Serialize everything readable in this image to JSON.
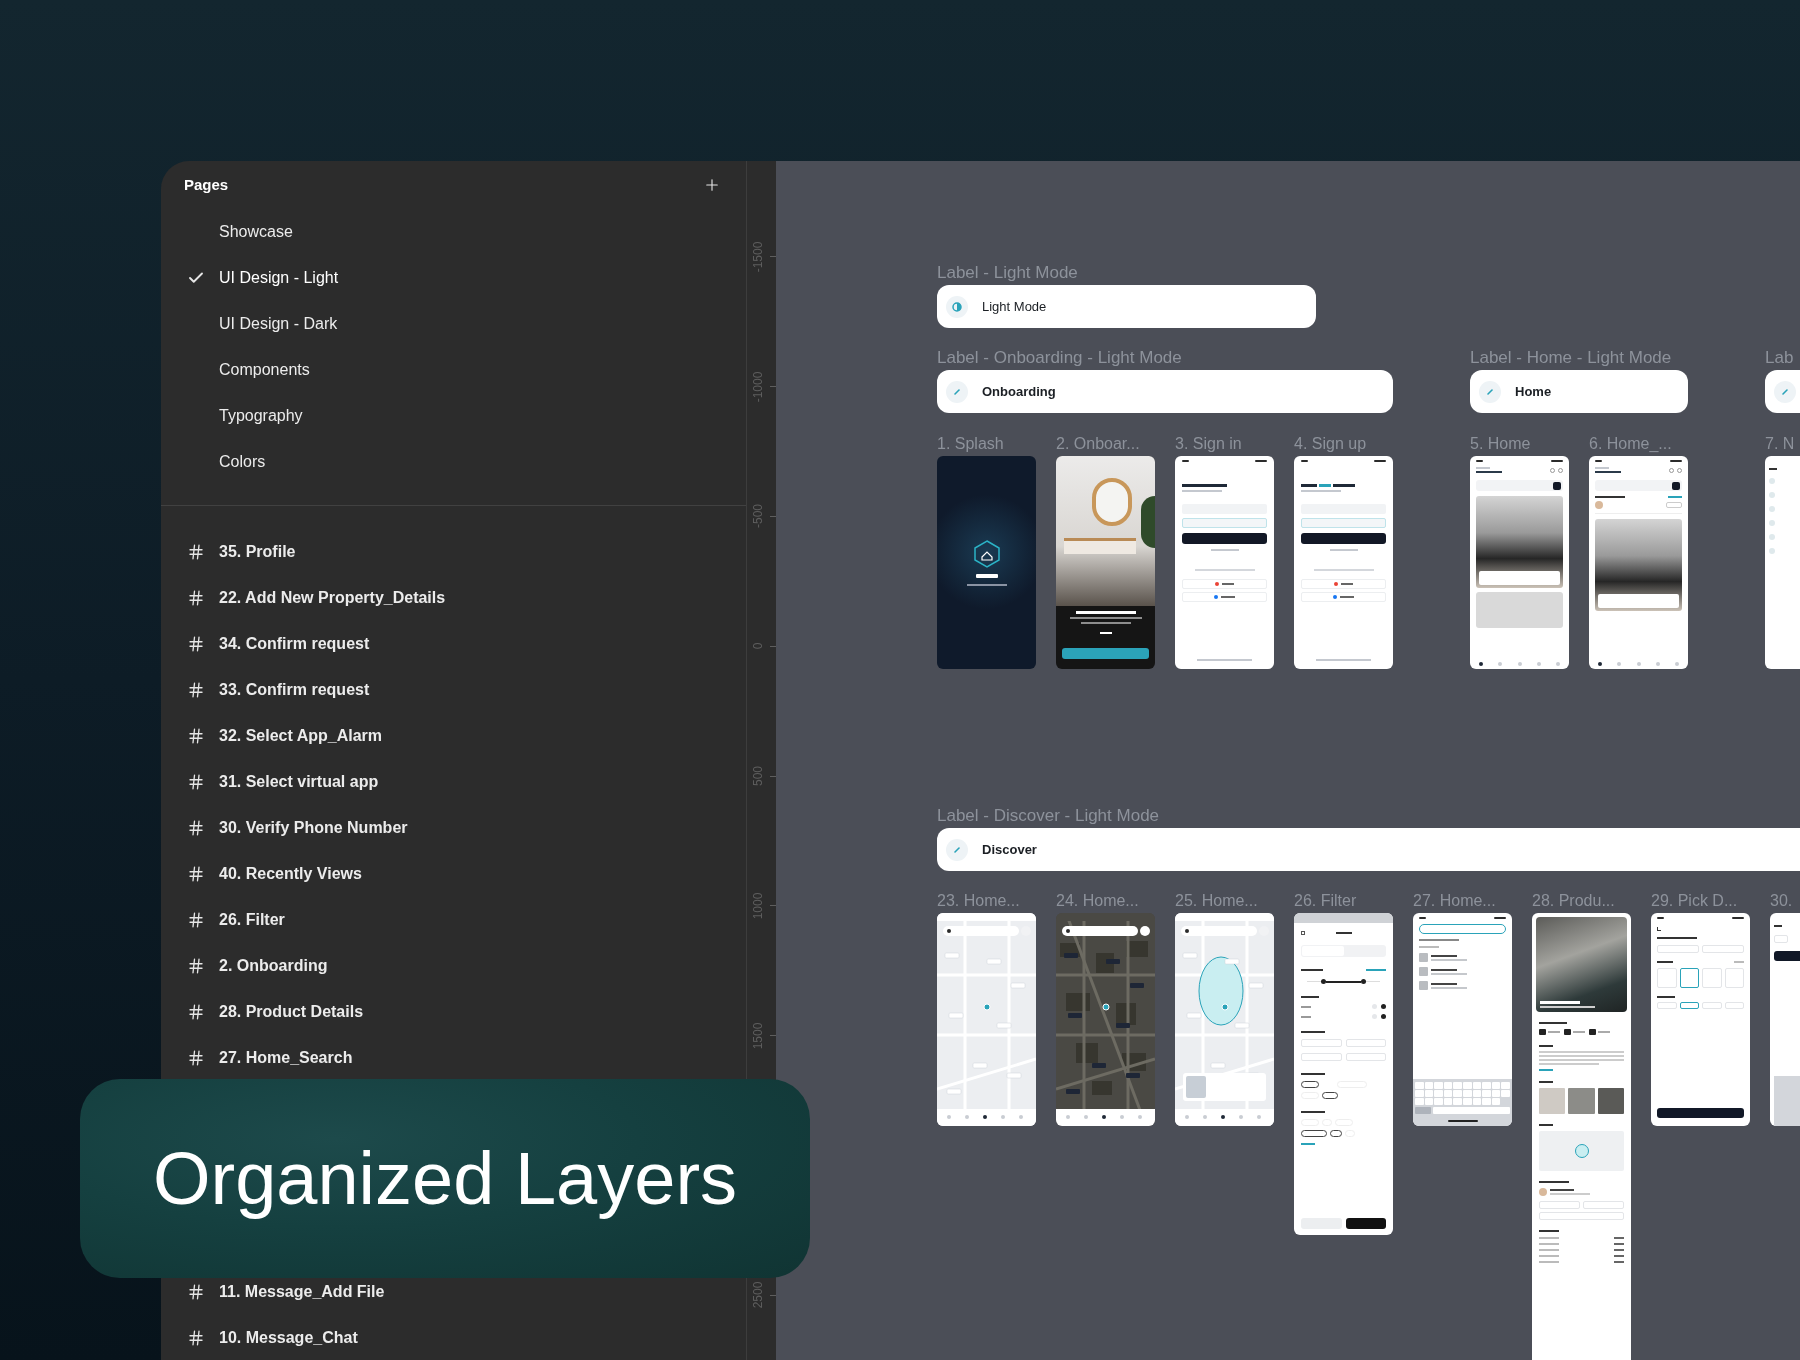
{
  "pages_panel": {
    "title": "Pages",
    "pages": [
      {
        "label": "Showcase",
        "selected": false
      },
      {
        "label": "UI Design - Light",
        "selected": true
      },
      {
        "label": "UI Design - Dark",
        "selected": false
      },
      {
        "label": "Components",
        "selected": false
      },
      {
        "label": "Typography",
        "selected": false
      },
      {
        "label": "Colors",
        "selected": false
      }
    ],
    "layers": [
      "35. Profile",
      "22. Add New Property_Details",
      "34. Confirm request",
      "33. Confirm request",
      "32. Select App_Alarm",
      "31. Select virtual app",
      "30. Verify Phone Number",
      "40. Recently Views",
      "26. Filter",
      "2. Onboarding",
      "28. Product Details",
      "27. Home_Search"
    ],
    "layers_after_banner": [
      "11. Message_Add File",
      "10. Message_Chat"
    ]
  },
  "ruler": {
    "marks": [
      "-1500",
      "-1000",
      "-500",
      "0",
      "500",
      "1000",
      "1500"
    ],
    "marks_after_banner": [
      "2500"
    ]
  },
  "canvas": {
    "mode_section": {
      "caption": "Label - Light Mode",
      "pill": {
        "kind": "mode",
        "label": "Light Mode"
      }
    },
    "groups": [
      {
        "caption": "Label - Onboarding - Light Mode",
        "pill": {
          "kind": "section",
          "label": "Onboarding"
        },
        "screens": [
          {
            "label": "1. Splash",
            "kind": "splash"
          },
          {
            "label": "2. Onboar...",
            "kind": "onboarding"
          },
          {
            "label": "3. Sign in",
            "kind": "sign-in"
          },
          {
            "label": "4. Sign up",
            "kind": "sign-up"
          }
        ]
      },
      {
        "caption": "Label - Home - Light Mode",
        "pill": {
          "kind": "section",
          "label": "Home"
        },
        "screens": [
          {
            "label": "5. Home",
            "kind": "home"
          },
          {
            "label": "6. Home_...",
            "kind": "home-detail"
          }
        ]
      },
      {
        "caption": "Lab",
        "pill": {
          "kind": "section"
        },
        "screens": [
          {
            "label": "7. N",
            "kind": "list-edge"
          }
        ]
      }
    ],
    "discover": {
      "caption": "Label - Discover - Light Mode",
      "pill": {
        "kind": "section",
        "label": "Discover"
      },
      "screens": [
        {
          "label": "23. Home...",
          "kind": "map"
        },
        {
          "label": "24. Home...",
          "kind": "satellite"
        },
        {
          "label": "25. Home...",
          "kind": "map-area"
        },
        {
          "label": "26. Filter",
          "kind": "filter"
        },
        {
          "label": "27. Home...",
          "kind": "search"
        },
        {
          "label": "28. Produ...",
          "kind": "product"
        },
        {
          "label": "29. Pick D...",
          "kind": "calendar"
        },
        {
          "label": "30.",
          "kind": "verify-edge"
        }
      ]
    }
  },
  "banner": {
    "title": "Organized Layers"
  }
}
